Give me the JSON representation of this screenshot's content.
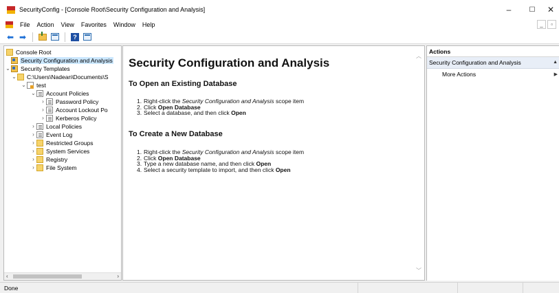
{
  "window": {
    "title": "SecurityConfig - [Console Root\\Security Configuration and Analysis]",
    "controls": {
      "minimize": "–",
      "maximize": "☐",
      "close": "✕"
    }
  },
  "menu": {
    "items": [
      "File",
      "Action",
      "View",
      "Favorites",
      "Window",
      "Help"
    ],
    "mdi_controls": [
      "_",
      "▫"
    ]
  },
  "toolbar": {
    "buttons": [
      "back-icon",
      "forward-icon",
      "up-folder-icon",
      "show-hide-tree-icon",
      "help-icon",
      "properties-icon"
    ]
  },
  "tree": {
    "items": [
      {
        "label": "Console Root",
        "icon": "folder-icon"
      },
      {
        "label": "Security Configuration and Analysis",
        "icon": "security-config-icon",
        "selected": true
      },
      {
        "label": "Security Templates",
        "icon": "security-templates-icon",
        "expanded": true
      },
      {
        "label": "C:\\Users\\Nadean\\Documents\\S",
        "icon": "folder-icon",
        "expanded": true
      },
      {
        "label": "test",
        "icon": "template-icon",
        "expanded": true
      },
      {
        "label": "Account Policies",
        "icon": "policy-icon",
        "expanded": true
      },
      {
        "label": "Password Policy",
        "icon": "policy-icon"
      },
      {
        "label": "Account Lockout Po",
        "icon": "policy-icon"
      },
      {
        "label": "Kerberos Policy",
        "icon": "policy-icon"
      },
      {
        "label": "Local Policies",
        "icon": "policy-icon"
      },
      {
        "label": "Event Log",
        "icon": "policy-icon"
      },
      {
        "label": "Restricted Groups",
        "icon": "folder-icon"
      },
      {
        "label": "System Services",
        "icon": "folder-icon"
      },
      {
        "label": "Registry",
        "icon": "folder-icon"
      },
      {
        "label": "File System",
        "icon": "folder-icon"
      }
    ]
  },
  "content": {
    "title": "Security Configuration and Analysis",
    "sections": [
      {
        "heading": "To Open an Existing Database",
        "steps": [
          {
            "num": "1.",
            "parts": [
              {
                "t": "Right-click the "
              },
              {
                "t": "Security Configuration and Analysis",
                "style": "i"
              },
              {
                "t": " scope item"
              }
            ]
          },
          {
            "num": "2.",
            "parts": [
              {
                "t": "Click "
              },
              {
                "t": "Open Database",
                "style": "b"
              }
            ]
          },
          {
            "num": "3.",
            "parts": [
              {
                "t": "Select a database, and then click "
              },
              {
                "t": "Open",
                "style": "b"
              }
            ]
          }
        ]
      },
      {
        "heading": "To Create a New Database",
        "steps": [
          {
            "num": "1.",
            "parts": [
              {
                "t": "Right-click the "
              },
              {
                "t": "Security Configuration and Analysis",
                "style": "i"
              },
              {
                "t": " scope item"
              }
            ]
          },
          {
            "num": "2.",
            "parts": [
              {
                "t": "Click "
              },
              {
                "t": "Open Database",
                "style": "b"
              }
            ]
          },
          {
            "num": "3.",
            "parts": [
              {
                "t": "Type a new database name, and then click "
              },
              {
                "t": "Open",
                "style": "b"
              }
            ]
          },
          {
            "num": "4.",
            "parts": [
              {
                "t": "Select a security template to import, and then click "
              },
              {
                "t": "Open",
                "style": "b"
              }
            ]
          }
        ]
      }
    ]
  },
  "actions": {
    "header": "Actions",
    "section": "Security Configuration and Analysis",
    "items": [
      "More Actions"
    ]
  },
  "status": {
    "text": "Done"
  }
}
